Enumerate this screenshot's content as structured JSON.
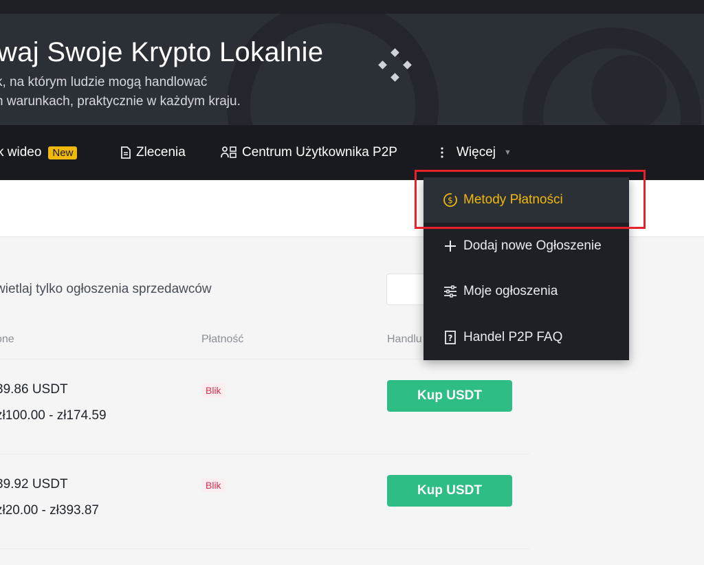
{
  "hero": {
    "title": "waj Swoje Krypto Lokalnie",
    "subtitle_line1": "k, na którym ludzie mogą handlować",
    "subtitle_line2": "h warunkach, praktycznie w każdym kraju."
  },
  "nav": {
    "video_label": "k wideo",
    "video_badge": "New",
    "orders_label": "Zlecenia",
    "user_center_label": "Centrum Użytkownika P2P",
    "more_label": "Więcej"
  },
  "dropdown": {
    "items": [
      {
        "label": "Metody Płatności",
        "icon": "payment-coin-icon"
      },
      {
        "label": "Dodaj nowe Ogłoszenie",
        "icon": "plus-icon"
      },
      {
        "label": "Moje ogłoszenia",
        "icon": "sliders-icon"
      },
      {
        "label": "Handel P2P FAQ",
        "icon": "faq-icon"
      }
    ]
  },
  "filter": {
    "label": "wietlaj tylko ogłoszenia sprzedawców"
  },
  "table": {
    "headers": [
      "one",
      "Płatność",
      "Handlu"
    ],
    "rows": [
      {
        "available": "39.86 USDT",
        "limit": "zł100.00 - zł174.59",
        "payment": "Blik",
        "action": "Kup USDT"
      },
      {
        "available": "39.92 USDT",
        "limit": "zł20.00 - zł393.87",
        "payment": "Blik",
        "action": "Kup USDT"
      }
    ]
  },
  "colors": {
    "accent": "#f0b90b",
    "buy": "#2ebd85",
    "highlight": "#e8202a",
    "navbar": "#181a20"
  }
}
